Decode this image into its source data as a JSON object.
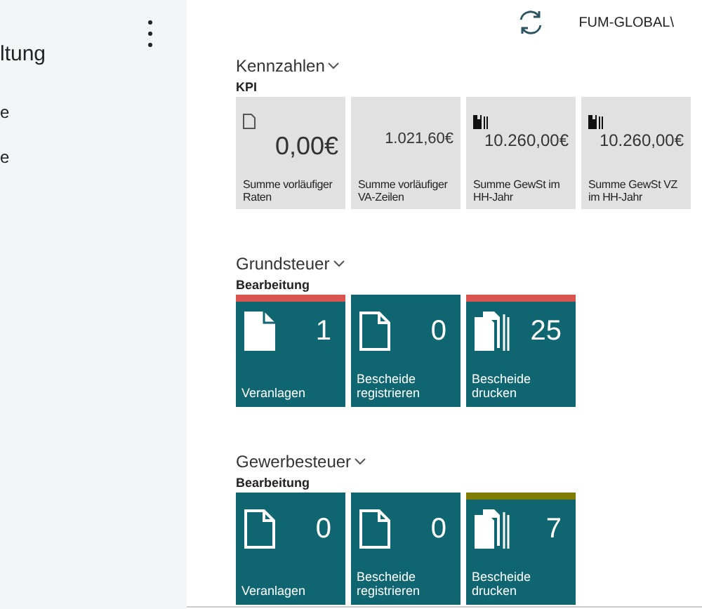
{
  "sidebar": {
    "title": "ltung",
    "items": [
      "e",
      "e"
    ]
  },
  "header": {
    "user": "FUM-GLOBAL\\"
  },
  "sections": [
    {
      "title": "Kennzahlen",
      "subtitle": "KPI",
      "kind": "kpi",
      "tiles": [
        {
          "kind": "page",
          "value": "0,00€",
          "label": "Summe vorläufiger Raten"
        },
        {
          "kind": "blank",
          "value": "1.021,60€",
          "label": "Summe vorläufiger VA-Zeilen"
        },
        {
          "kind": "ledger",
          "value": "10.260,00€",
          "label": "Summe GewSt im HH-Jahr"
        },
        {
          "kind": "ledger",
          "value": "10.260,00€",
          "label": "Summe GewSt VZ im HH-Jahr"
        }
      ]
    },
    {
      "title": "Grundsteuer",
      "subtitle": "Bearbeitung",
      "kind": "action",
      "tiles": [
        {
          "kind": "filled-page",
          "value": "1",
          "label": "Veranlagen",
          "color": "#d9534f"
        },
        {
          "kind": "outline-page",
          "value": "0",
          "label": "Bescheide registrieren"
        },
        {
          "kind": "stack",
          "value": "25",
          "label": "Bescheide drucken",
          "color": "#d9534f"
        }
      ]
    },
    {
      "title": "Gewerbesteuer",
      "subtitle": "Bearbeitung",
      "kind": "action",
      "tiles": [
        {
          "kind": "outline-page",
          "value": "0",
          "label": "Veranlagen"
        },
        {
          "kind": "outline-page",
          "value": "0",
          "label": "Bescheide registrieren"
        },
        {
          "kind": "stack",
          "value": "7",
          "label": "Bescheide drucken",
          "color": "#7f7a00"
        }
      ]
    }
  ]
}
